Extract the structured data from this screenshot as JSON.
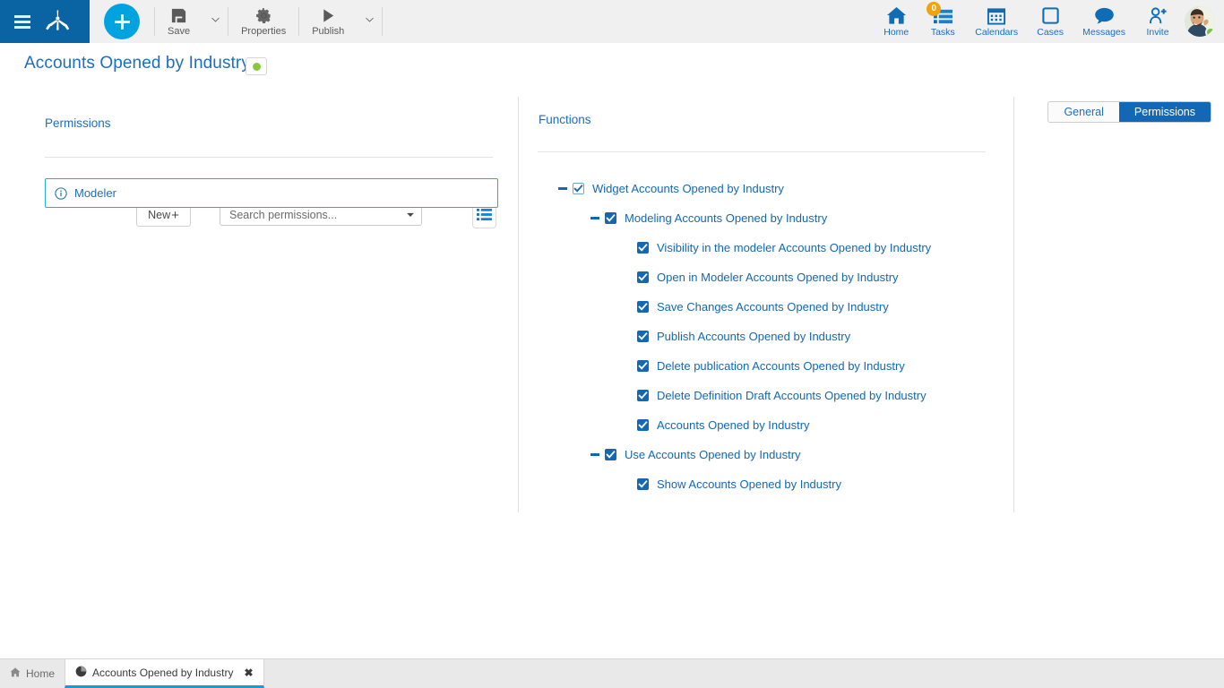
{
  "topbar": {
    "menu_icon": "hamburger-icon",
    "logo_icon": "app-logo-icon",
    "add_button_label": "+",
    "tools": [
      {
        "label": "Save",
        "icon": "save-icon",
        "has_caret": true
      },
      {
        "label": "Properties",
        "icon": "gear-icon",
        "has_caret": false
      },
      {
        "label": "Publish",
        "icon": "play-icon",
        "has_caret": true
      }
    ],
    "nav": [
      {
        "label": "Home",
        "icon": "home-icon",
        "badge": null
      },
      {
        "label": "Tasks",
        "icon": "tasks-icon",
        "badge": "0"
      },
      {
        "label": "Calendars",
        "icon": "calendar-icon",
        "badge": null
      },
      {
        "label": "Cases",
        "icon": "cases-icon",
        "badge": null
      },
      {
        "label": "Messages",
        "icon": "message-icon",
        "badge": null
      },
      {
        "label": "Invite",
        "icon": "invite-user-icon",
        "badge": null
      }
    ],
    "avatar": {
      "name": "avatar",
      "status_color": "#7ac143"
    }
  },
  "header": {
    "title": "Accounts Opened by Industry",
    "status_dot_color": "#8cc63e",
    "tabs": [
      {
        "label": "General",
        "active": false
      },
      {
        "label": "Permissions",
        "active": true
      }
    ]
  },
  "left_panel": {
    "section_label": "Permissions",
    "new_button_label": "New",
    "new_button_plus": "+",
    "search": {
      "placeholder": "Search permissions...",
      "value": "",
      "caret_icon": "chevron-down-icon"
    },
    "list_view_icon": "list-view-icon",
    "items": [
      {
        "label": "Modeler",
        "icon": "info-icon",
        "selected": true
      }
    ]
  },
  "right_panel": {
    "section_label": "Functions",
    "tree": [
      {
        "label": "Widget Accounts Opened by Industry",
        "depth": 0,
        "checked": true,
        "checkbox_style": "outline",
        "expandable": true
      },
      {
        "label": "Modeling Accounts Opened by Industry",
        "depth": 1,
        "checked": true,
        "checkbox_style": "filled",
        "expandable": true
      },
      {
        "label": "Visibility in the modeler Accounts Opened by Industry",
        "depth": 2,
        "checked": true,
        "checkbox_style": "filled",
        "expandable": false
      },
      {
        "label": "Open in Modeler Accounts Opened by Industry",
        "depth": 2,
        "checked": true,
        "checkbox_style": "filled",
        "expandable": false
      },
      {
        "label": "Save Changes Accounts Opened by Industry",
        "depth": 2,
        "checked": true,
        "checkbox_style": "filled",
        "expandable": false
      },
      {
        "label": "Publish Accounts Opened by Industry",
        "depth": 2,
        "checked": true,
        "checkbox_style": "filled",
        "expandable": false
      },
      {
        "label": "Delete publication Accounts Opened by Industry",
        "depth": 2,
        "checked": true,
        "checkbox_style": "filled",
        "expandable": false
      },
      {
        "label": "Delete Definition Draft Accounts Opened by Industry",
        "depth": 2,
        "checked": true,
        "checkbox_style": "filled",
        "expandable": false
      },
      {
        "label": " Accounts Opened by Industry",
        "depth": 2,
        "checked": true,
        "checkbox_style": "filled",
        "expandable": false
      },
      {
        "label": "Use Accounts Opened by Industry",
        "depth": 1,
        "checked": true,
        "checkbox_style": "filled",
        "expandable": true
      },
      {
        "label": "Show Accounts Opened by Industry",
        "depth": 2,
        "checked": true,
        "checkbox_style": "filled",
        "expandable": false
      }
    ]
  },
  "taskbar": {
    "tabs": [
      {
        "label": "Home",
        "icon": "home-small-icon",
        "active": false,
        "closable": false
      },
      {
        "label": "Accounts Opened by Industry",
        "icon": "pie-chart-icon",
        "active": true,
        "closable": true,
        "close_label": "✖"
      }
    ]
  },
  "colors": {
    "brand_blue": "#0a64a4",
    "accent_cyan": "#00a3e0",
    "link_blue": "#1b6ec2",
    "tab_active": "#1368b5",
    "badge_orange": "#f0a30a",
    "status_green": "#8cc63e"
  }
}
